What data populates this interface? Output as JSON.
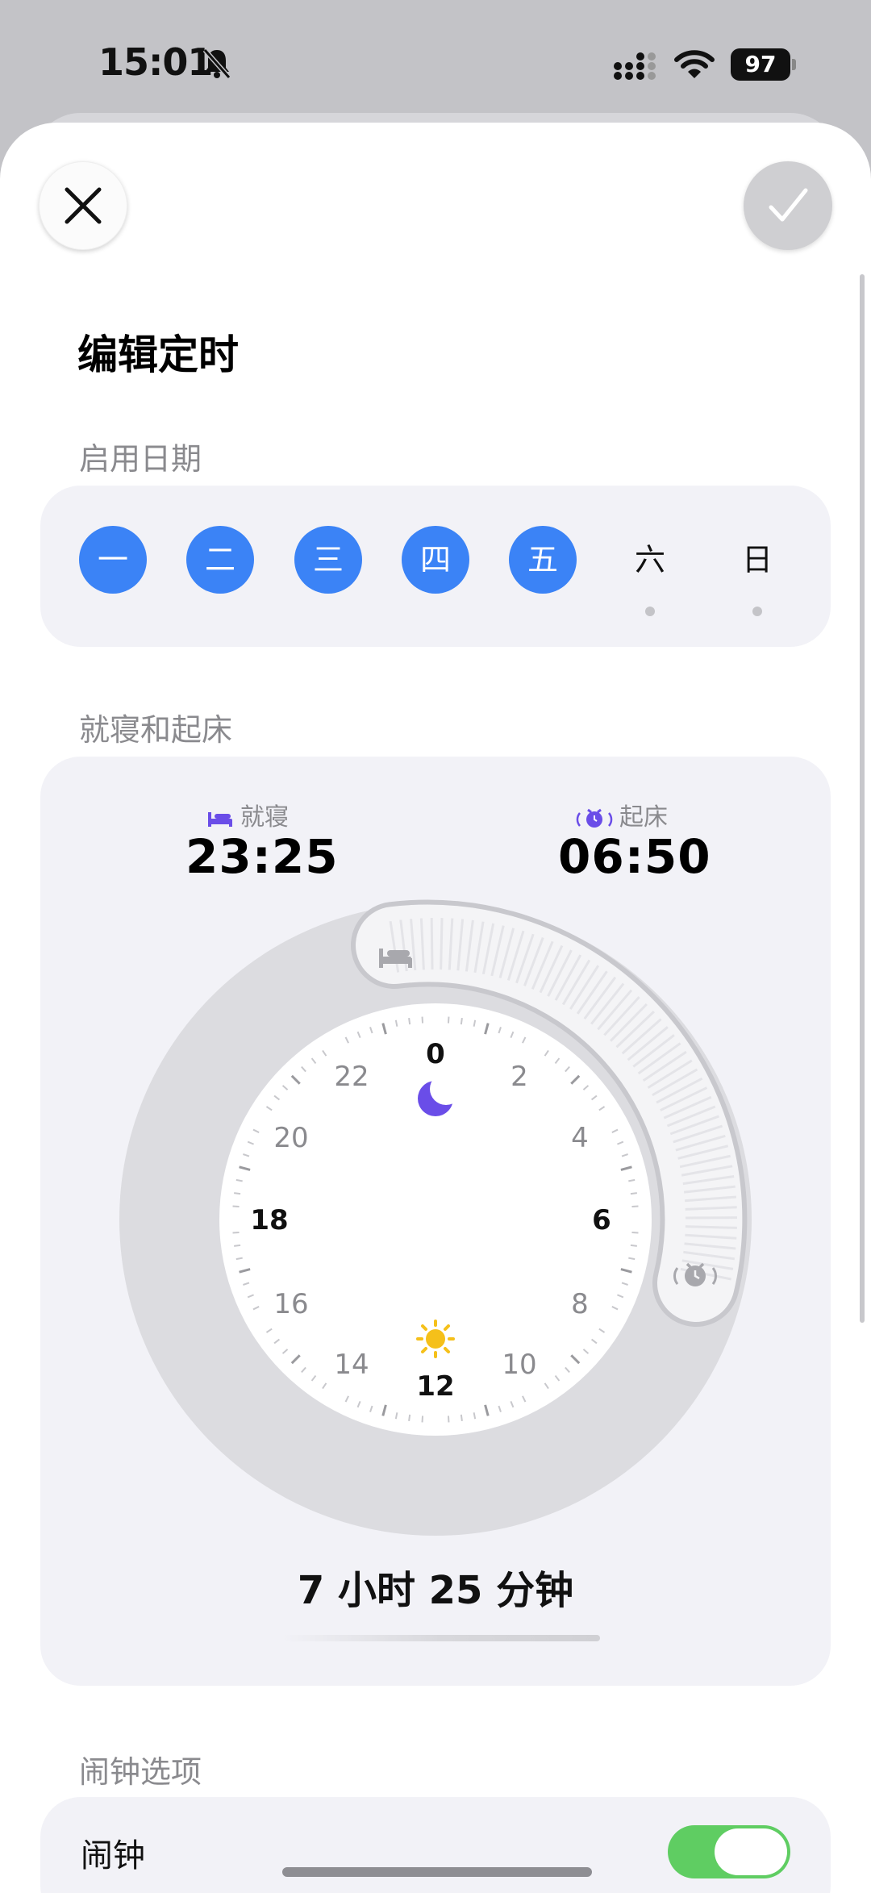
{
  "status_bar": {
    "time": "15:01",
    "battery": "97",
    "icons": [
      "bell-off-icon",
      "signal-icon",
      "wifi-icon",
      "battery-icon"
    ]
  },
  "header": {
    "close_icon": "close-icon",
    "confirm_icon": "checkmark-icon"
  },
  "page": {
    "title": "编辑定时"
  },
  "schedule": {
    "label": "启用日期",
    "days": [
      {
        "label": "一",
        "enabled": true
      },
      {
        "label": "二",
        "enabled": true
      },
      {
        "label": "三",
        "enabled": true
      },
      {
        "label": "四",
        "enabled": true
      },
      {
        "label": "五",
        "enabled": true
      },
      {
        "label": "六",
        "enabled": false
      },
      {
        "label": "日",
        "enabled": false
      }
    ]
  },
  "sleep": {
    "label": "就寝和起床",
    "bedtime_label": "就寝",
    "bedtime_value": "23:25",
    "bedtime_icon": "bed-icon",
    "wake_label": "起床",
    "wake_value": "06:50",
    "wake_icon": "alarm-clock-icon",
    "dial_labels": [
      "0",
      "2",
      "4",
      "6",
      "8",
      "10",
      "12",
      "14",
      "16",
      "18",
      "20",
      "22"
    ],
    "center_icons": [
      "moon-icon",
      "sun-icon"
    ],
    "duration": "7 小时 25 分钟"
  },
  "alarm_options": {
    "label": "闹钟选项",
    "alarm_label": "闹钟",
    "alarm_enabled": true
  },
  "colors": {
    "accent_blue": "#3b83f6",
    "moon_purple": "#6a4de8",
    "sun_yellow": "#f5c01a",
    "toggle_green": "#5fcd62",
    "card_bg": "#f2f2f7"
  }
}
